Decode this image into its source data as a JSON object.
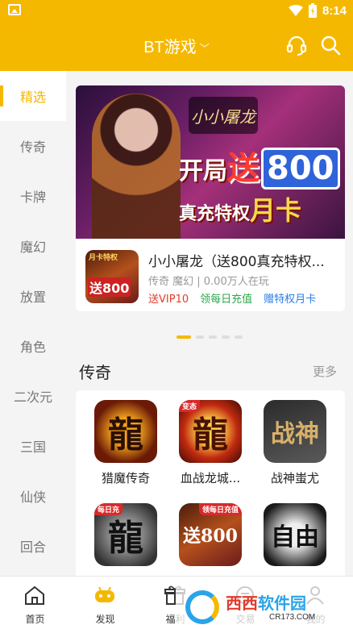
{
  "status_bar": {
    "time": "8:14",
    "icons": [
      "image-icon",
      "wifi-icon",
      "battery-icon"
    ]
  },
  "header": {
    "title": "BT游戏",
    "title_chevron": "﹀",
    "actions": [
      "headset-icon",
      "search-icon"
    ],
    "background": "#f5b800"
  },
  "sidebar": {
    "items": [
      {
        "label": "精选",
        "active": true
      },
      {
        "label": "传奇"
      },
      {
        "label": "卡牌"
      },
      {
        "label": "魔幻"
      },
      {
        "label": "放置"
      },
      {
        "label": "角色"
      },
      {
        "label": "二次元"
      },
      {
        "label": "三国"
      },
      {
        "label": "仙侠"
      },
      {
        "label": "回合"
      }
    ]
  },
  "banner": {
    "logo_text": "小小屠龙",
    "line1_prefix": "开局",
    "line1_send": "送",
    "line1_number": "800",
    "line2_prefix": "真充特权",
    "line2_month": "月卡",
    "game": {
      "name": "小小屠龙（送800真充特权...",
      "meta": "传奇 魔幻 | 0.00万人在玩",
      "icon_badge": "月卡特权",
      "icon_number": "送800",
      "tags": [
        {
          "text": "送VIP10",
          "color": "#e23b2b"
        },
        {
          "text": "领每日充值",
          "color": "#2aa84a"
        },
        {
          "text": "赠特权月卡",
          "color": "#2a7de8"
        }
      ]
    },
    "page_index": 1,
    "page_count": 5
  },
  "section": {
    "title": "传奇",
    "more": "更多",
    "games": [
      {
        "name": "猎魔传奇",
        "glyph": "龍"
      },
      {
        "name": "血战龙城...",
        "glyph": "龍",
        "ribbon": "变态"
      },
      {
        "name": "战神蚩尤",
        "glyph": "战神"
      },
      {
        "name": "",
        "glyph": "龍",
        "ribbon": "每日充"
      },
      {
        "name": "",
        "glyph": "送800",
        "ribbon": "领每日充值"
      },
      {
        "name": "",
        "glyph": "自由"
      }
    ]
  },
  "tabbar": {
    "tabs": [
      {
        "label": "首页",
        "icon": "home-icon"
      },
      {
        "label": "发现",
        "icon": "gamepad-icon",
        "active": true
      },
      {
        "label": "福利",
        "icon": "gift-icon"
      },
      {
        "label": "交易",
        "icon": "trade-icon"
      },
      {
        "label": "我的",
        "icon": "user-icon"
      }
    ]
  },
  "watermark": {
    "brand_a": "西西",
    "brand_b": "软件园",
    "url": "CR173.COM"
  }
}
